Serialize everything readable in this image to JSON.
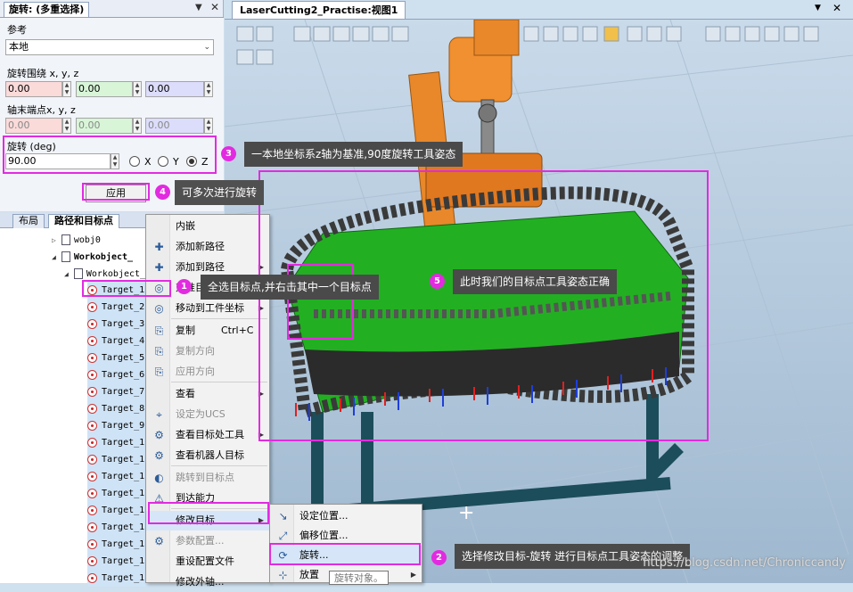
{
  "rotate_panel": {
    "title": "旋转: (多重选择)",
    "reference_label": "参考",
    "reference_value": "本地",
    "rotate_around_label": "旋转围绕  x, y, z",
    "rotate_around": [
      "0.00",
      "0.00",
      "0.00"
    ],
    "axis_end_label": "轴末端点x, y, z",
    "axis_end": [
      "0.00",
      "0.00",
      "0.00"
    ],
    "rotation_label": "旋转 (deg)",
    "rotation_value": "90.00",
    "axis_options": [
      "X",
      "Y",
      "Z"
    ],
    "axis_selected": "Z",
    "apply_label": "应用"
  },
  "browser": {
    "tabs": [
      "布局",
      "路径和目标点"
    ],
    "active_tab": "路径和目标点",
    "nodes": [
      "wobj0",
      "Workobject_",
      "Workobject_"
    ],
    "targets": [
      "Target_1",
      "Target_2",
      "Target_3",
      "Target_4",
      "Target_5",
      "Target_6",
      "Target_7",
      "Target_8",
      "Target_9",
      "Target_1",
      "Target_1",
      "Target_1",
      "Target_1",
      "Target_1",
      "Target_1",
      "Target_1",
      "Target_1",
      "Target_1"
    ]
  },
  "viewport": {
    "tab_title": "LaserCutting2_Practise:视图1"
  },
  "context_menu": {
    "items": [
      {
        "label": "内嵌",
        "disabled": false
      },
      {
        "label": "添加新路径",
        "disabled": false
      },
      {
        "label": "添加到路径",
        "disabled": false,
        "submenu": true
      },
      {
        "label": "对准目标点方向",
        "disabled": false
      },
      {
        "label": "移动到工件坐标",
        "disabled": false,
        "submenu": true
      },
      {
        "label": "复制",
        "shortcut": "Ctrl+C",
        "disabled": false
      },
      {
        "label": "复制方向",
        "disabled": true
      },
      {
        "label": "应用方向",
        "disabled": true
      },
      {
        "label": "查看",
        "disabled": false,
        "submenu": true
      },
      {
        "label": "设定为UCS",
        "disabled": true
      },
      {
        "label": "查看目标处工具",
        "disabled": false,
        "submenu": true
      },
      {
        "label": "查看机器人目标",
        "disabled": false
      },
      {
        "label": "跳转到目标点",
        "disabled": true
      },
      {
        "label": "到达能力",
        "disabled": false
      },
      {
        "label": "修改目标",
        "disabled": false,
        "submenu": true
      },
      {
        "label": "参数配置...",
        "disabled": true
      },
      {
        "label": "重设配置文件",
        "disabled": false
      },
      {
        "label": "修改外轴...",
        "disabled": false
      }
    ]
  },
  "sub_menu": {
    "items": [
      "设定位置...",
      "偏移位置...",
      "旋转...",
      "放置"
    ],
    "tooltip": "旋转对象。"
  },
  "annotations": [
    {
      "n": "1",
      "text": "全选目标点,并右击其中一个目标点"
    },
    {
      "n": "2",
      "text": "选择修改目标-旋转 进行目标点工具姿态的调整"
    },
    {
      "n": "3",
      "text": "一本地坐标系z轴为基准,90度旋转工具姿态"
    },
    {
      "n": "4",
      "text": "可多次进行旋转"
    },
    {
      "n": "5",
      "text": "此时我们的目标点工具姿态正确"
    }
  ],
  "watermark": "https://blog.csdn.net/Chroniccandy",
  "colors": {
    "highlight": "#e22be0",
    "table_green": "#22b022",
    "robot_orange": "#e8882a",
    "x_field": "#fbdada",
    "y_field": "#d8f5d8",
    "z_field": "#dcdcfb"
  }
}
